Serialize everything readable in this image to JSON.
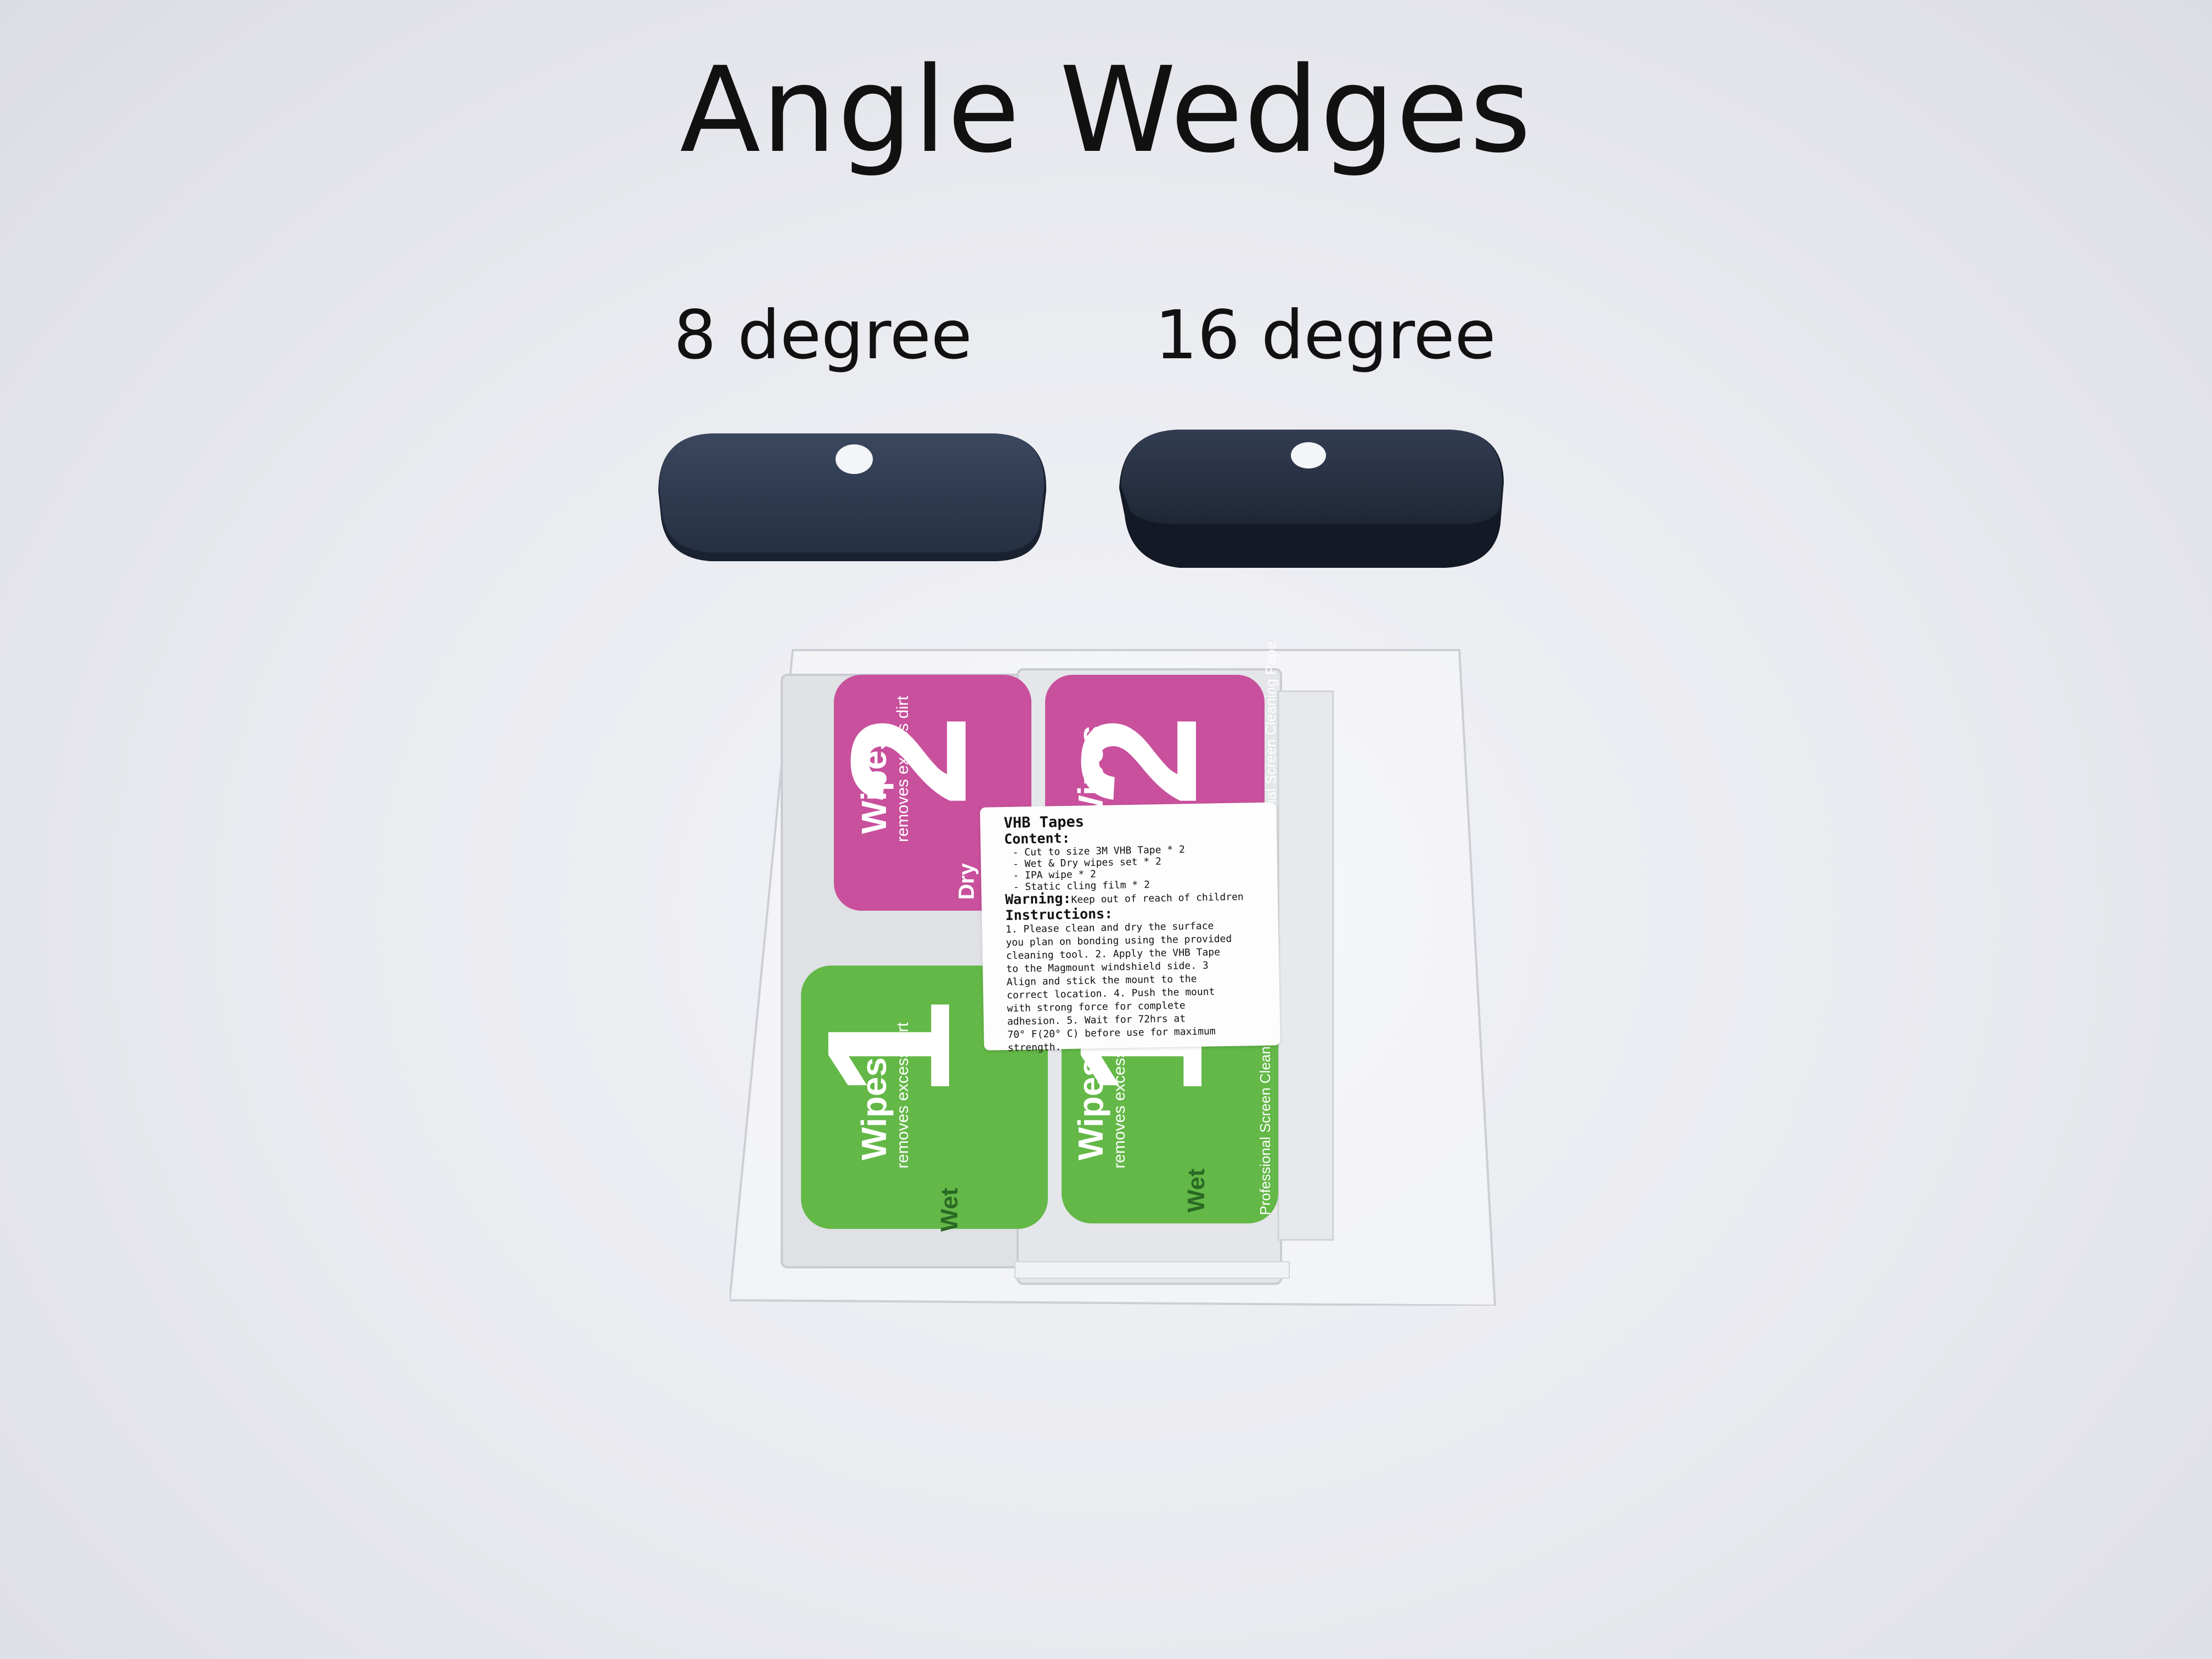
{
  "title": "Angle Wedges",
  "wedges": [
    {
      "label": "8 degree"
    },
    {
      "label": "16 degree"
    }
  ],
  "colors": {
    "background": "#eceef2",
    "wedge": "#2b3547",
    "wipe_pink": "#c8509c",
    "wipe_green": "#63b847",
    "wipe_border": "#c9ccd0"
  },
  "wipes": {
    "brand": "Wipes",
    "tagline": "removes excess dirt",
    "side_text": "Professional Screen Cleaning Paper",
    "pink": {
      "number": "2",
      "type": "Dry"
    },
    "green": {
      "number": "1",
      "type": "Wet"
    }
  },
  "sticker": {
    "title": "VHB Tapes",
    "content_heading": "Content:",
    "content_items": [
      "- Cut to size 3M VHB Tape * 2",
      "- Wet & Dry wipes set * 2",
      "- IPA wipe * 2",
      "- Static cling film * 2"
    ],
    "warning_label": "Warning:",
    "warning_text": "Keep out of reach of children",
    "instructions_heading": "Instructions:",
    "instructions_lines": [
      "1. Please clean and dry the surface",
      "you plan on bonding using the provided",
      "cleaning tool. 2. Apply the VHB Tape",
      "to the Magmount windshield side. 3",
      "Align and stick the mount to the",
      "correct location. 4. Push the mount",
      "with strong force for complete",
      "adhesion. 5. Wait for 72hrs at",
      "70° F(20° C) before use for maximum",
      "strength."
    ]
  }
}
